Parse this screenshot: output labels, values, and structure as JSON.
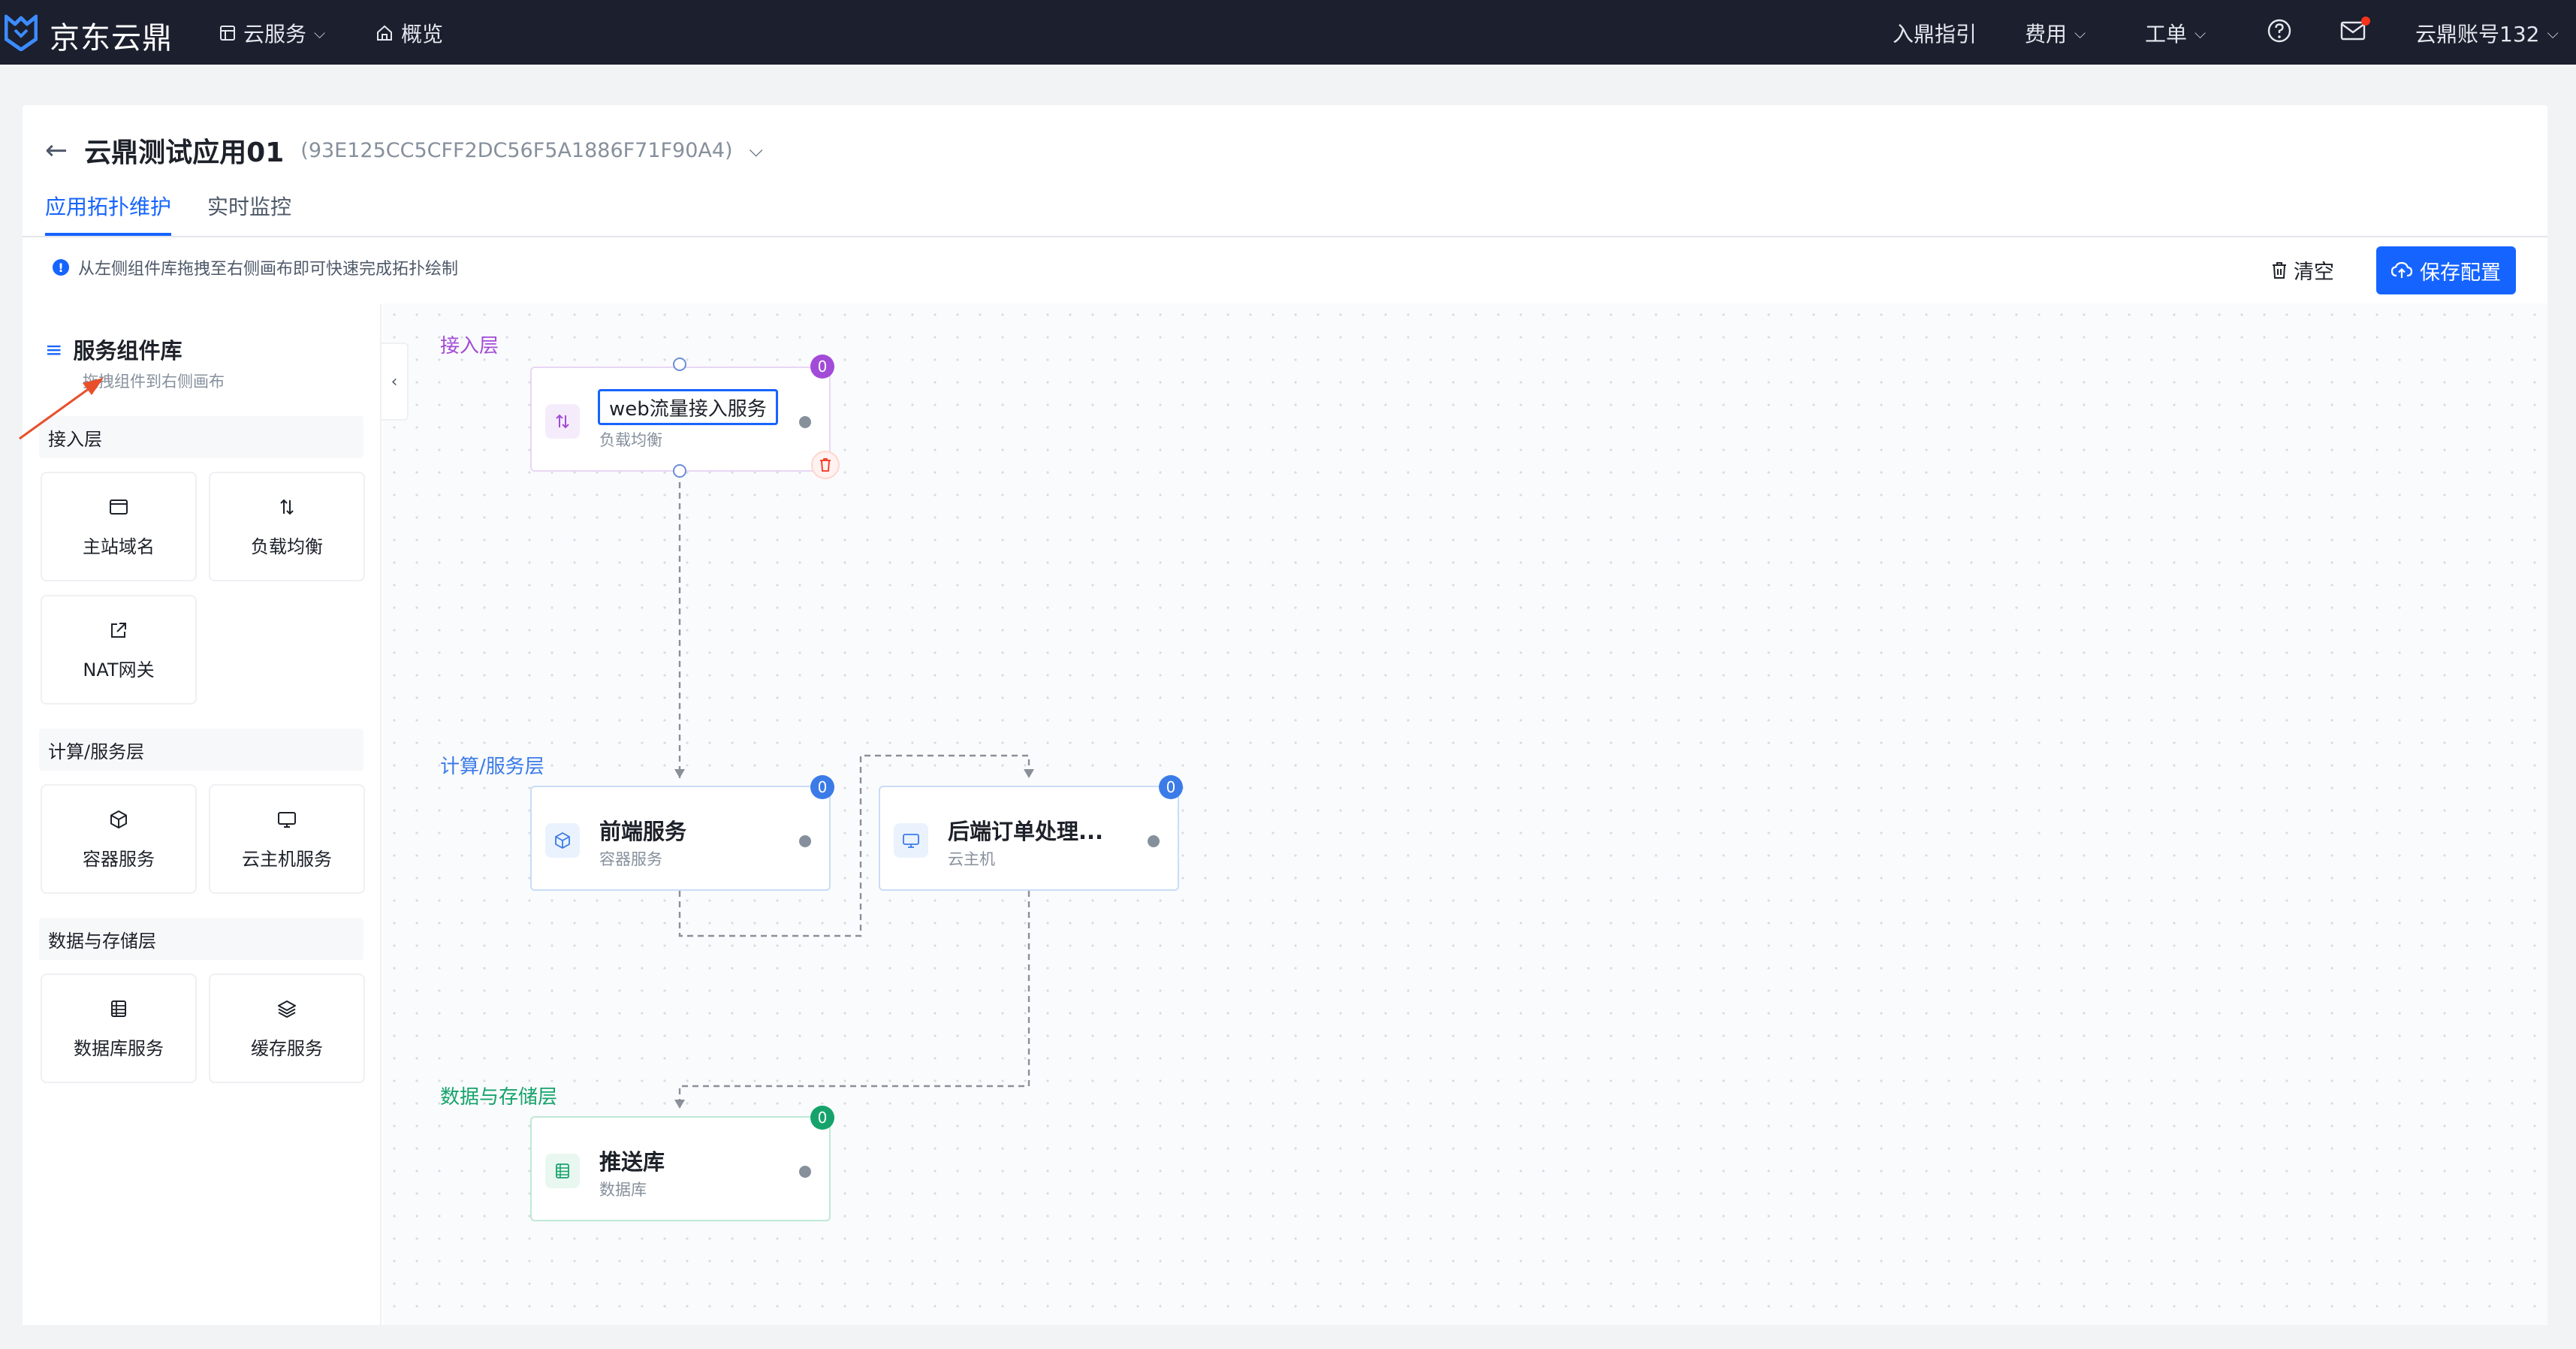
{
  "topnav": {
    "brand": "京东云鼎",
    "cloud_service": "云服务",
    "overview": "概览",
    "onboarding_guide": "入鼎指引",
    "billing": "费用",
    "tickets": "工单",
    "account": "云鼎账号132"
  },
  "app": {
    "title": "云鼎测试应用01",
    "id": "(93E125CC5CFF2DC56F5A1886F71F90A4)"
  },
  "tabs": [
    {
      "label": "应用拓扑维护",
      "active": true
    },
    {
      "label": "实时监控",
      "active": false
    }
  ],
  "toolbar": {
    "hint": "从左侧组件库拖拽至右侧画布即可快速完成拓扑绘制",
    "clear_label": "清空",
    "save_label": "保存配置"
  },
  "library": {
    "title": "服务组件库",
    "subtitle": "拖拽组件到右侧画布",
    "sections": [
      {
        "title": "接入层",
        "items": [
          {
            "label": "主站域名",
            "icon": "browser-window-icon"
          },
          {
            "label": "负载均衡",
            "icon": "swap-vertical-icon"
          },
          {
            "label": "NAT网关",
            "icon": "external-link-icon"
          }
        ]
      },
      {
        "title": "计算/服务层",
        "items": [
          {
            "label": "容器服务",
            "icon": "cube-icon"
          },
          {
            "label": "云主机服务",
            "icon": "monitor-icon"
          }
        ]
      },
      {
        "title": "数据与存储层",
        "items": [
          {
            "label": "数据库服务",
            "icon": "table-icon"
          },
          {
            "label": "缓存服务",
            "icon": "layers-icon"
          }
        ]
      }
    ]
  },
  "canvas": {
    "layers": [
      {
        "label": "接入层",
        "color": "#a24bd8"
      },
      {
        "label": "计算/服务层",
        "color": "#3b7be8"
      },
      {
        "label": "数据与存储层",
        "color": "#16a36b"
      }
    ],
    "nodes": [
      {
        "name": "web流量接入服务",
        "type": "负载均衡",
        "badge": "0",
        "editing": true
      },
      {
        "name": "前端服务",
        "type": "容器服务",
        "badge": "0"
      },
      {
        "name": "后端订单处理...",
        "type": "云主机",
        "badge": "0"
      },
      {
        "name": "推送库",
        "type": "数据库",
        "badge": "0"
      }
    ]
  },
  "colors": {
    "accent": "#1664ff",
    "nav_bg": "#1b1f2e",
    "access_layer": "#a24bd8",
    "compute_layer": "#3b7be8",
    "data_layer": "#16a36b",
    "annotation_arrow": "#e8502b"
  }
}
